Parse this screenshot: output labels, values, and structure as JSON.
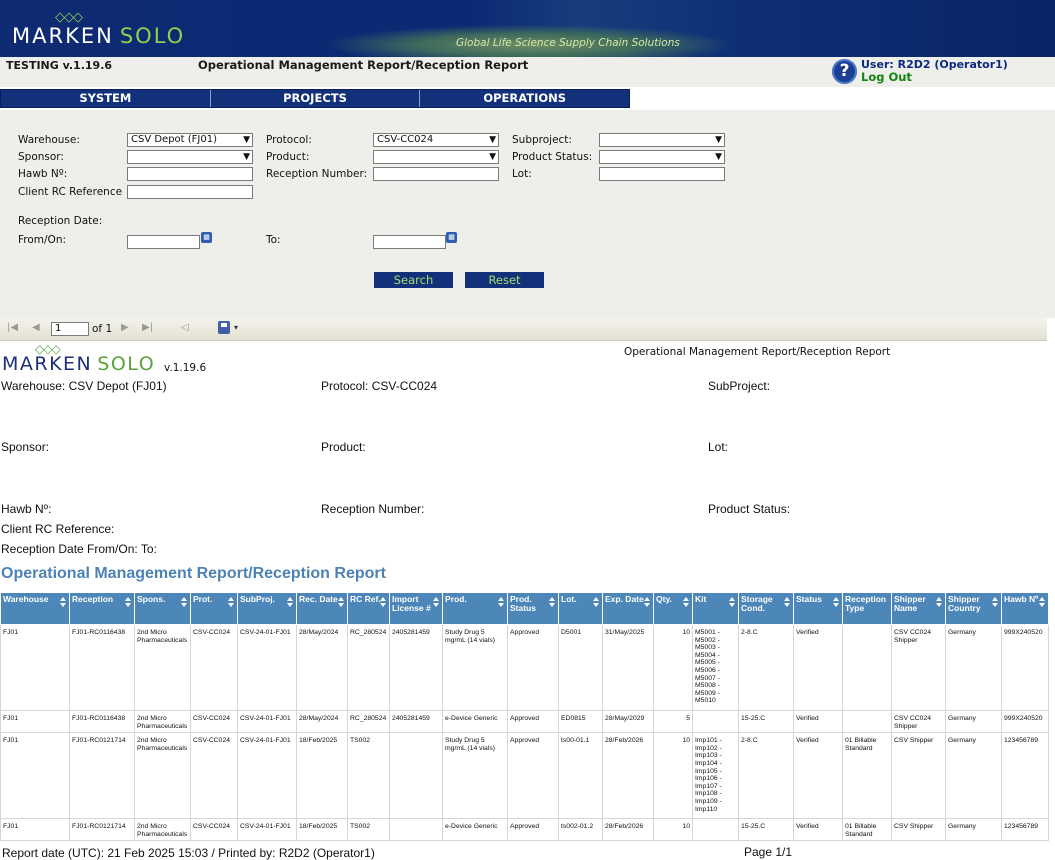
{
  "banner": {
    "logo_mark": "◇◇◇",
    "logo_word1": "MARKEN",
    "logo_word2": "SOLO",
    "tagline": "Global Life Science Supply Chain Solutions"
  },
  "header": {
    "version": "TESTING v.1.19.6",
    "title": "Operational Management Report/Reception Report",
    "help_glyph": "?",
    "user": "User: R2D2 (Operator1)",
    "logout": "Log Out"
  },
  "nav": {
    "items": [
      "SYSTEM",
      "PROJECTS",
      "OPERATIONS"
    ]
  },
  "filters": {
    "warehouse": {
      "label": "Warehouse:",
      "value": "CSV Depot (FJ01)"
    },
    "protocol": {
      "label": "Protocol:",
      "value": "CSV-CC024"
    },
    "subproject": {
      "label": "Subproject:",
      "value": ""
    },
    "sponsor": {
      "label": "Sponsor:",
      "value": ""
    },
    "product": {
      "label": "Product:",
      "value": ""
    },
    "product_status": {
      "label": "Product Status:",
      "value": ""
    },
    "hawb": {
      "label": "Hawb Nº:",
      "value": ""
    },
    "reception_number": {
      "label": "Reception Number:",
      "value": ""
    },
    "lot": {
      "label": "Lot:",
      "value": ""
    },
    "client_rc": {
      "label": "Client RC Reference",
      "value": ""
    },
    "reception_date_label": "Reception Date:",
    "from_on": {
      "label": "From/On:",
      "value": ""
    },
    "to": {
      "label": "To:",
      "value": ""
    },
    "search_label": "Search",
    "reset_label": "Reset"
  },
  "toolbar": {
    "first": "|◀",
    "prev": "◀",
    "page": "1",
    "of": "of 1",
    "next": "▶",
    "last": "▶|",
    "back": "◁",
    "save_menu": "▾"
  },
  "report": {
    "logo_mark": "◇◇◇",
    "logo_word1": "MARKEN",
    "logo_word2": "SOLO",
    "version": "v.1.19.6",
    "title_right": "Operational Management Report/Reception Report",
    "warehouse": "Warehouse: CSV Depot (FJ01)",
    "protocol": "Protocol: CSV-CC024",
    "subproject": "SubProject:",
    "sponsor": "Sponsor:",
    "product": "Product:",
    "lot": "Lot:",
    "hawb": "Hawb Nº:",
    "reception_number": "Reception Number:",
    "product_status": "Product Status:",
    "client_rc": "Client RC Reference:",
    "reception_date": "Reception Date From/On:  To:",
    "heading": "Operational Management Report/Reception Report",
    "footer_left": "Report date (UTC): 21 Feb 2025 15:03 / Printed by: R2D2 (Operator1)",
    "footer_right": "Page 1/1"
  },
  "table": {
    "columns": [
      {
        "label": "Warehouse",
        "sortable": true
      },
      {
        "label": "Reception",
        "sortable": true
      },
      {
        "label": "Spons.",
        "sortable": true
      },
      {
        "label": "Prot.",
        "sortable": true
      },
      {
        "label": "SubProj.",
        "sortable": true
      },
      {
        "label": "Rec. Date",
        "sortable": true
      },
      {
        "label": "RC Ref.",
        "sortable": true
      },
      {
        "label": "Import License #",
        "sortable": true
      },
      {
        "label": "Prod.",
        "sortable": true
      },
      {
        "label": "Prod. Status",
        "sortable": true
      },
      {
        "label": "Lot.",
        "sortable": true
      },
      {
        "label": "Exp. Date",
        "sortable": true
      },
      {
        "label": "Qty.",
        "sortable": true
      },
      {
        "label": "Kit",
        "sortable": true
      },
      {
        "label": "Storage Cond.",
        "sortable": true
      },
      {
        "label": "Status",
        "sortable": true
      },
      {
        "label": "Reception Type",
        "sortable": false
      },
      {
        "label": "Shipper Name",
        "sortable": true
      },
      {
        "label": "Shipper Country",
        "sortable": true
      },
      {
        "label": "Hawb Nº",
        "sortable": true
      }
    ],
    "rows": [
      [
        "FJ01",
        "FJ01-RC0116438",
        "2nd Micro Pharmaceuticals",
        "CSV-CC024",
        "CSV-24-01-FJ01",
        "28/May/2024",
        "RC_280524",
        "2405281459",
        "Study Drug 5 mg/mL (14 vials)",
        "Approved",
        "D5001",
        "31/May/2025",
        "10",
        "M5001 - M5002 - M5003 - M5004 - M5005 - M5006 - M5007 - M5008 - M5009 - M5010",
        "2-8.C",
        "Verified",
        "",
        "CSV CC024 Shipper",
        "Germany",
        "999X240520"
      ],
      [
        "FJ01",
        "FJ01-RC0116438",
        "2nd Micro Pharmaceuticals",
        "CSV-CC024",
        "CSV-24-01-FJ01",
        "28/May/2024",
        "RC_280524",
        "2405281459",
        "e-Device Generic",
        "Approved",
        "ED0815",
        "28/May/2029",
        "5",
        "",
        "15-25.C",
        "Verified",
        "",
        "CSV CC024 Shipper",
        "Germany",
        "999X240520"
      ],
      [
        "FJ01",
        "FJ01-RC0121714",
        "2nd Micro Pharmaceuticals",
        "CSV-CC024",
        "CSV-24-01-FJ01",
        "18/Feb/2025",
        "TS002",
        "",
        "Study Drug 5 mg/mL (14 vials)",
        "Approved",
        "ts00-01.1",
        "28/Feb/2026",
        "10",
        "Imp101 - Imp102 - Imp103 - Imp104 - Imp105 - Imp106 - Imp107 - Imp108 - Imp109 - Imp110",
        "2-8.C",
        "Verified",
        "01 Billable Standard",
        "CSV Shipper",
        "Germany",
        "123456789"
      ],
      [
        "FJ01",
        "FJ01-RC0121714",
        "2nd Micro Pharmaceuticals",
        "CSV-CC024",
        "CSV-24-01-FJ01",
        "18/Feb/2025",
        "TS002",
        "",
        "e-Device Generic",
        "Approved",
        "ts002-01.2",
        "28/Feb/2026",
        "10",
        "",
        "15-25.C",
        "Verified",
        "01 Billable Standard",
        "CSV Shipper",
        "Germany",
        "123456789"
      ]
    ]
  }
}
